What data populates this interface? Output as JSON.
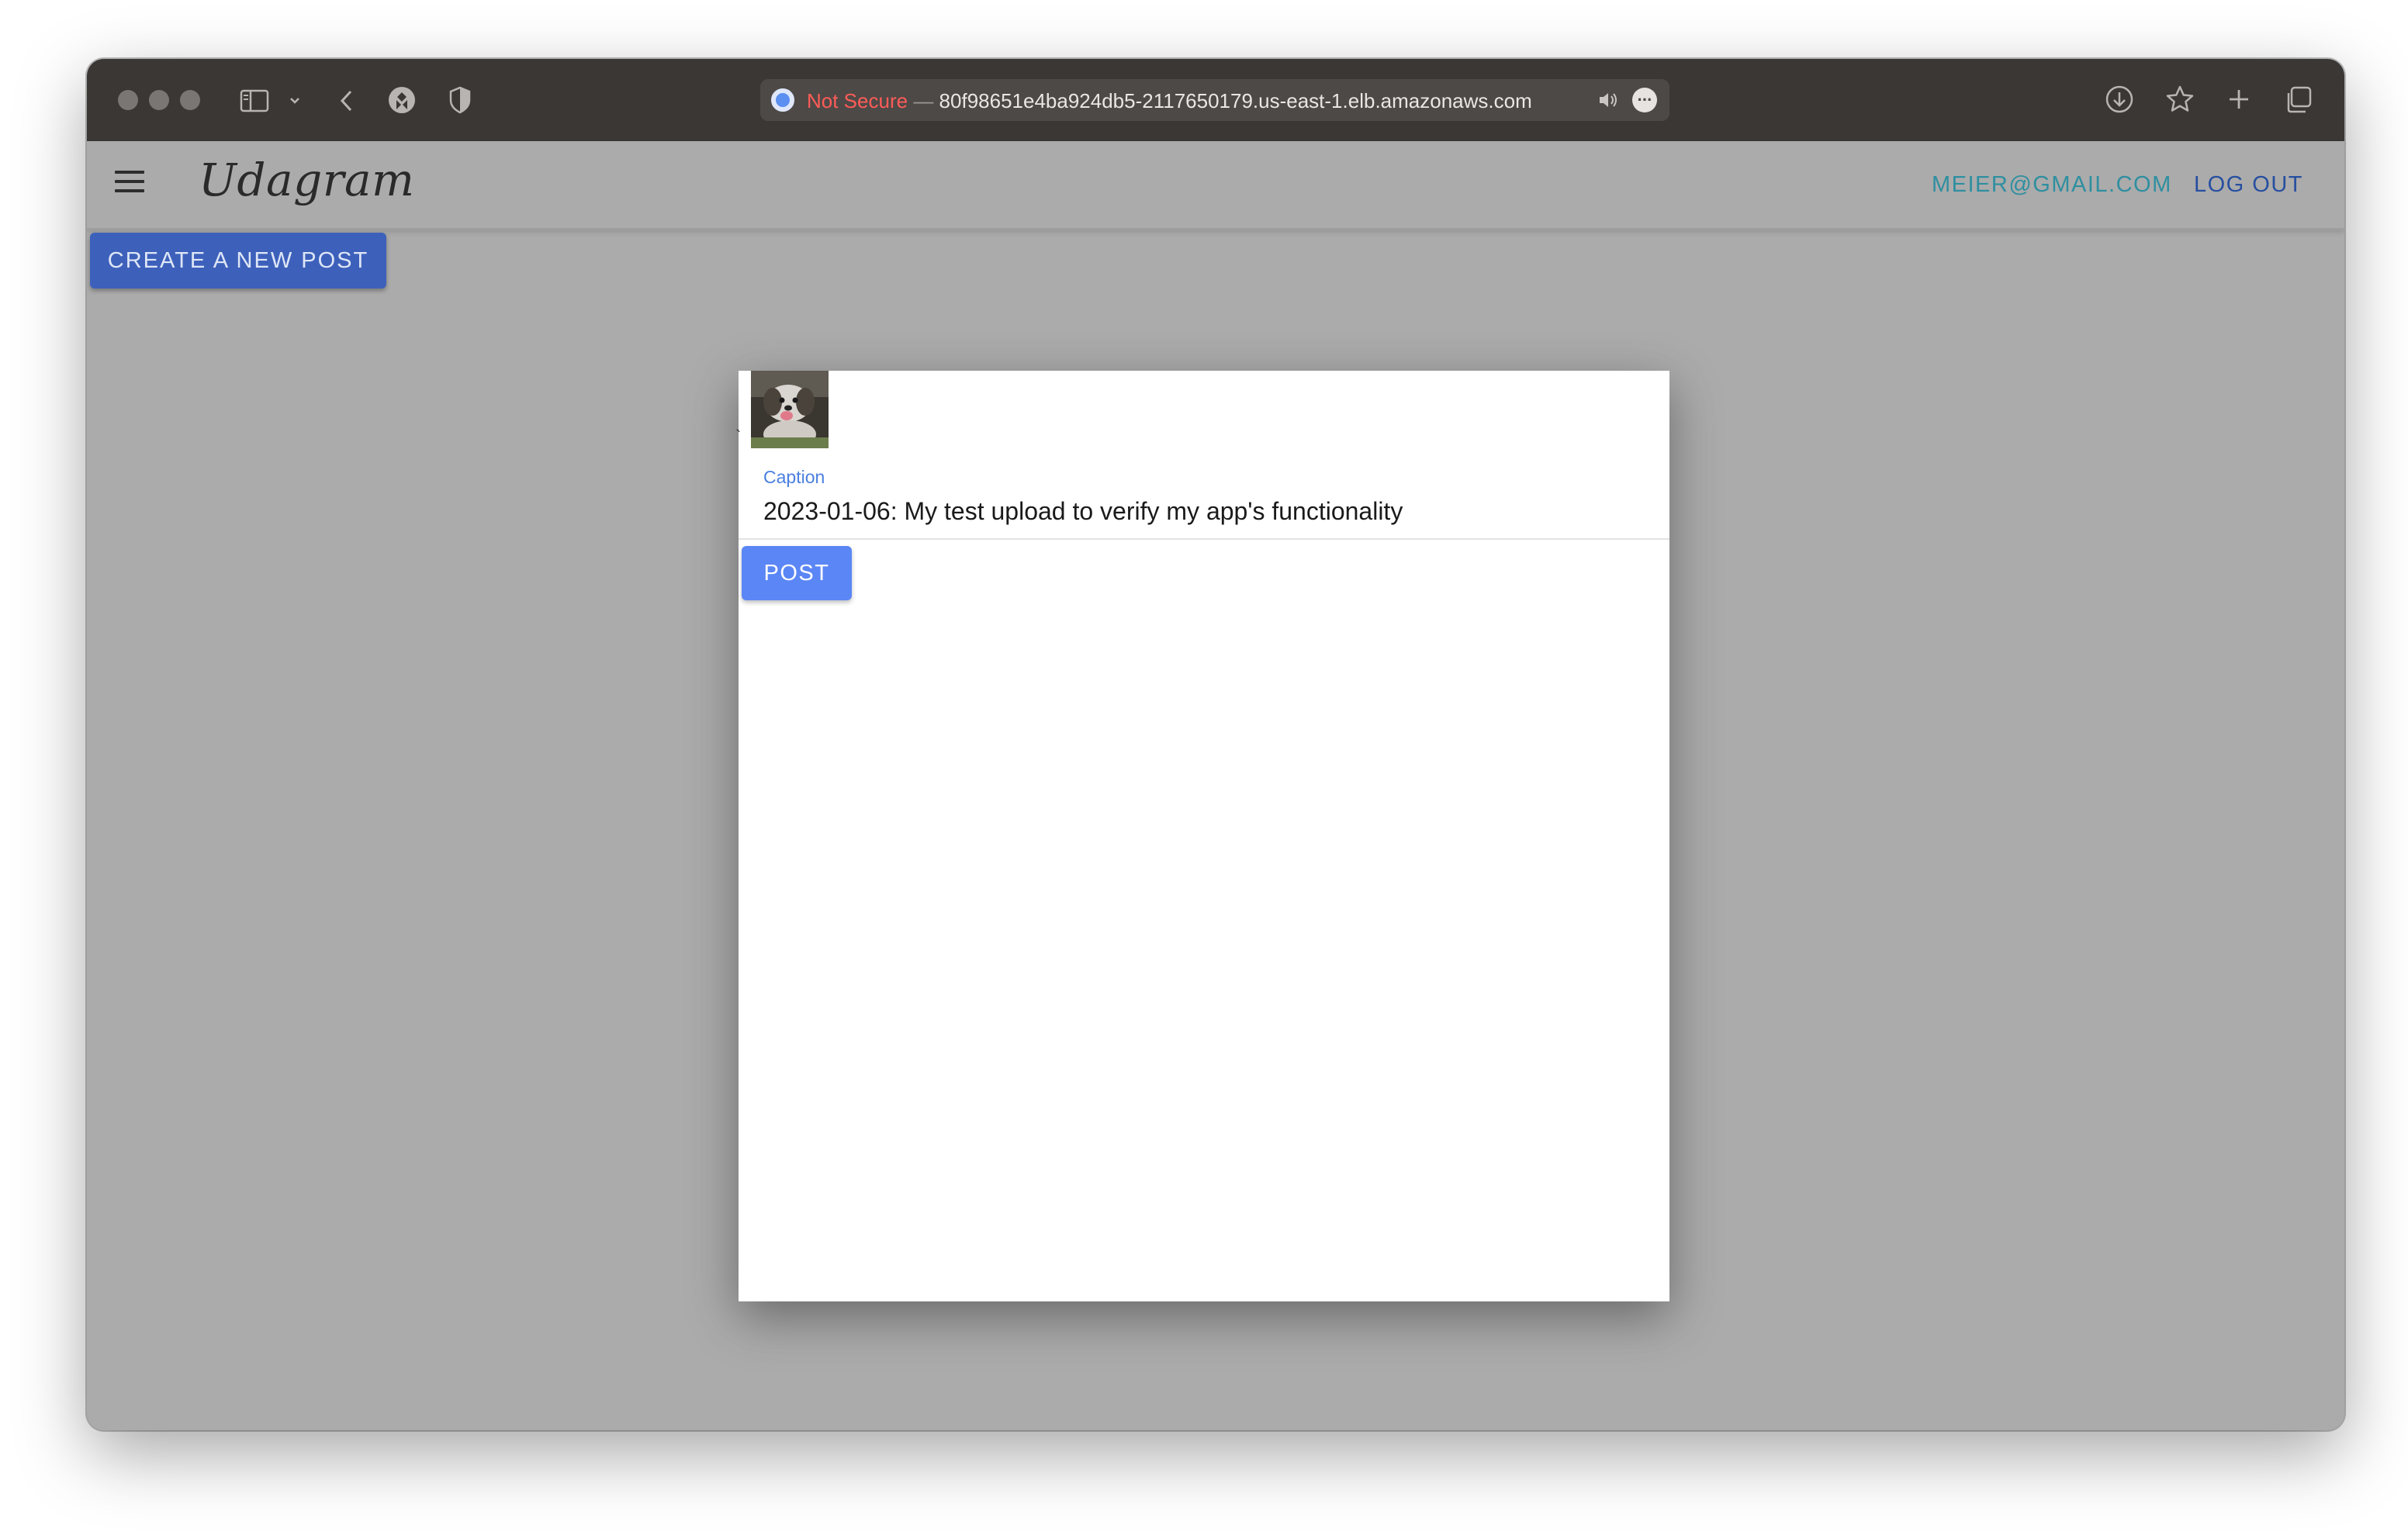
{
  "browser": {
    "address_bar": {
      "security_label": "Not Secure",
      "separator": "—",
      "host": "80f98651e4ba924db5-2117650179.us-east-1.elb.amazonaws.com"
    },
    "icons": [
      "sidebar-icon",
      "chevron-down-icon",
      "back-icon",
      "extension-icon",
      "privacy-shield-icon",
      "speaker-icon",
      "more-icon",
      "download-icon",
      "star-icon",
      "new-tab-icon",
      "tabs-overview-icon"
    ]
  },
  "app": {
    "logo": "Udagram",
    "nav": {
      "user_email": "MEIER@GMAIL.COM",
      "logout_label": "LOG OUT"
    },
    "create_button_label": "CREATE A NEW POST",
    "colors": {
      "page_background": "#ababab",
      "create_button": "#3d61bb",
      "post_button": "#5b86f5",
      "email_link": "#2e8fa0",
      "logout_link": "#274fa0",
      "caption_label": "#4a7fe0"
    }
  },
  "modal": {
    "caption_label": "Caption",
    "caption_value": "2023-01-06: My test upload to verify my app's functionality",
    "post_button_label": "POST"
  }
}
